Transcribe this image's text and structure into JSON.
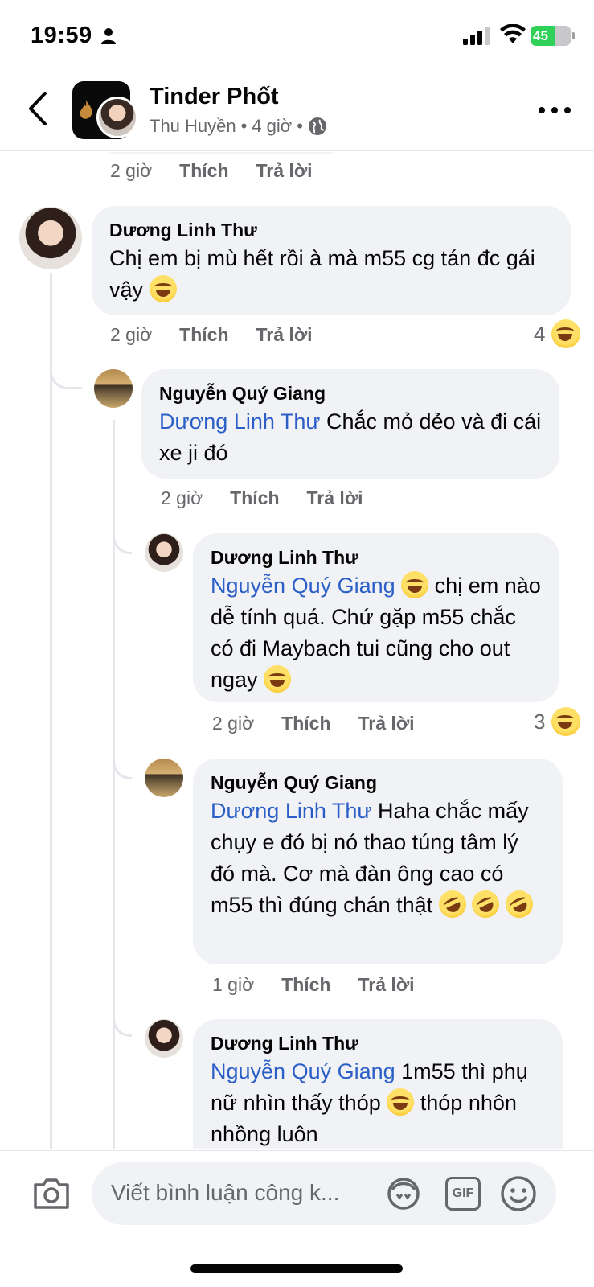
{
  "status_bar": {
    "time": "19:59",
    "battery": "45"
  },
  "header": {
    "title": "Tinder Phốt",
    "author": "Thu Huyền",
    "separator": "•",
    "time": "4 giờ"
  },
  "top_actions": {
    "time": "2 giờ",
    "like": "Thích",
    "reply": "Trả lời"
  },
  "comments": [
    {
      "author": "Dương Linh Thư",
      "text": "Chị em bị mù hết rồi à mà m55 cg tán đc gái vậy",
      "emojis": [
        "laugh-emoji"
      ],
      "time": "2 giờ",
      "like": "Thích",
      "reply": "Trả lời",
      "reaction_count": "4"
    },
    {
      "author": "Nguyễn Quý Giang",
      "mention": "Dương Linh Thư",
      "text": "Chắc mỏ dẻo và đi cái xe ji đó",
      "time": "2 giờ",
      "like": "Thích",
      "reply": "Trả lời"
    },
    {
      "author": "Dương Linh Thư",
      "mention": "Nguyễn Quý Giang",
      "text_part1": "chị em",
      "text_part2": "nào dễ tính quá. Chứ gặp m55",
      "text_part3": "chắc có đi Maybach tui cũng",
      "text_part4": "cho out ngay",
      "time": "2 giờ",
      "like": "Thích",
      "reply": "Trả lời",
      "reaction_count": "3"
    },
    {
      "author": "Nguyễn Quý Giang",
      "mention": "Dương Linh Thư",
      "text_part1": "Haha chắc",
      "text_part2": "mấy chụy e đó bị nó thao túng",
      "text_part3": "tâm lý đó mà. Cơ mà đàn ông",
      "text_part4": "cao có m55 thì đúng chán thật",
      "time": "1 giờ",
      "like": "Thích",
      "reply": "Trả lời"
    },
    {
      "author": "Dương Linh Thư",
      "mention": "Nguyễn Quý Giang",
      "text_part1": "1m55 thì",
      "text_part2": "phụ nữ nhìn thấy thóp",
      "text_part3": "thóp",
      "text_part4": "nhôn nhồng luôn"
    }
  ],
  "composer": {
    "placeholder": "Viết bình luận công k..."
  },
  "icons": {
    "back": "chevron-left-icon",
    "more": "more-horizontal-icon",
    "globe": "globe-icon",
    "camera": "camera-icon",
    "avatar_sticker": "avatar-sticker-icon",
    "gif": "gif-icon",
    "emoji": "smile-icon"
  },
  "colors": {
    "mention": "#2b5fc7",
    "bubble": "#f0f2f5",
    "secondary_text": "#65676b",
    "battery": "#30d158"
  }
}
